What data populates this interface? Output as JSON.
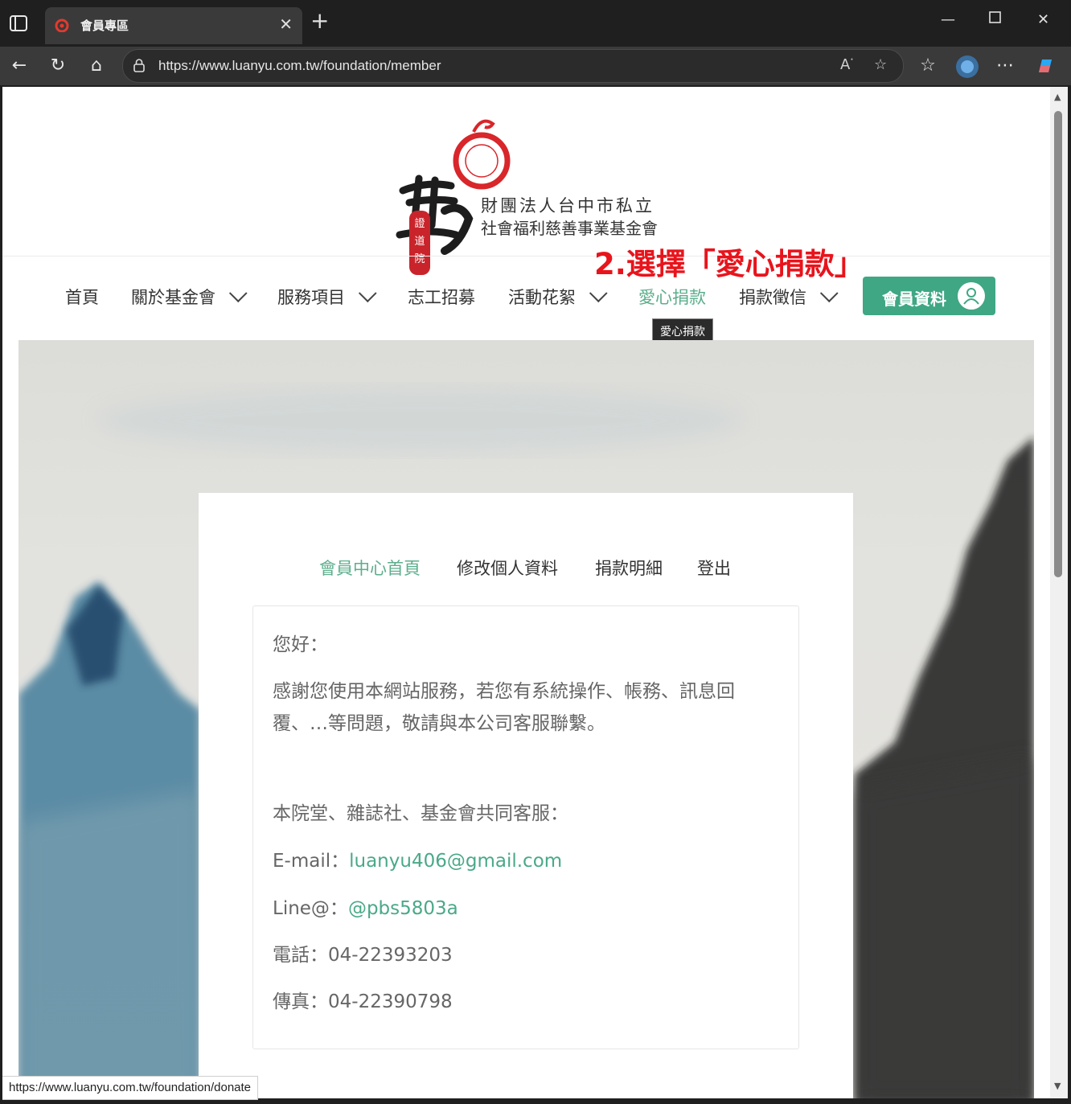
{
  "browser": {
    "tab_title": "會員專區",
    "url": "https://www.luanyu.com.tw/foundation/member",
    "status_url": "https://www.luanyu.com.tw/foundation/donate"
  },
  "logo": {
    "line1": "財團法人台中市私立",
    "line2": "社會福利慈善事業基金會"
  },
  "nav": {
    "items": [
      "首頁",
      "關於基金會",
      "服務項目",
      "志工招募",
      "活動花絮",
      "愛心捐款",
      "捐款徵信"
    ],
    "member_button": "會員資料",
    "tooltip": "愛心捐款"
  },
  "annotation": "2.選擇「愛心捐款」",
  "member": {
    "tabs": [
      "會員中心首頁",
      "修改個人資料",
      "捐款明細",
      "登出"
    ],
    "greeting": "您好：",
    "message1": "感謝您使用本網站服務，若您有系統操作、帳務、訊息回",
    "message2": "覆、…等問題，敬請與本公司客服聯繫。",
    "service_title": "本院堂、雜誌社、基金會共同客服：",
    "email_label": "E-mail：",
    "email": "luanyu406@gmail.com",
    "line_label": "Line@：",
    "line_id": "@pbs5803a",
    "phone": "電話：04-22393203",
    "fax": "傳真：04-22390798"
  },
  "colors": {
    "accent": "#3fa783",
    "link": "#4aa987",
    "annotation": "#e8141c"
  }
}
